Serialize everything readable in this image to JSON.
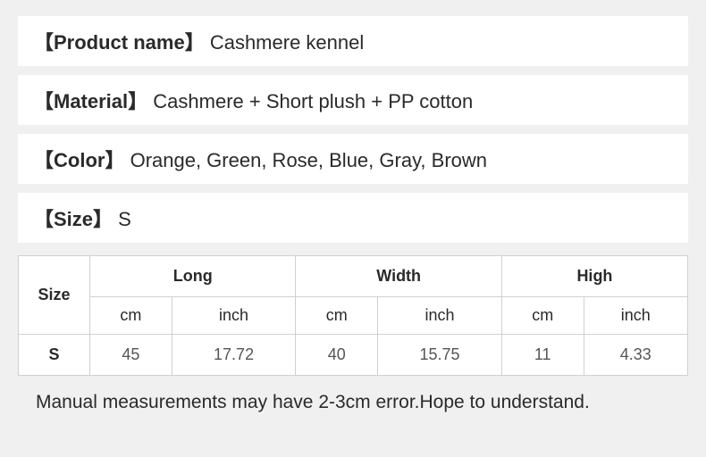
{
  "info": {
    "productNameLabel": "【Product name】",
    "productNameValue": "Cashmere kennel",
    "materialLabel": "【Material】",
    "materialValue": "Cashmere + Short plush + PP cotton",
    "colorLabel": "【Color】",
    "colorValue": "Orange, Green, Rose, Blue, Gray, Brown",
    "sizeLabel": "【Size】",
    "sizeValue": "S"
  },
  "table": {
    "headers": {
      "size": "Size",
      "long": "Long",
      "width": "Width",
      "high": "High",
      "cm": "cm",
      "inch": "inch"
    },
    "row": {
      "size": "S",
      "long_cm": "45",
      "long_inch": "17.72",
      "width_cm": "40",
      "width_inch": "15.75",
      "high_cm": "11",
      "high_inch": "4.33"
    }
  },
  "note": "Manual measurements may have 2-3cm error.Hope to understand."
}
